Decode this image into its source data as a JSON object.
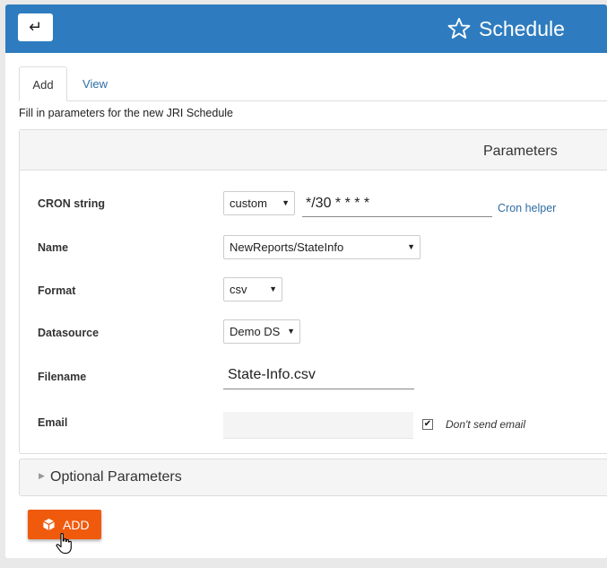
{
  "header": {
    "back_icon": "↵",
    "title": "Schedule",
    "title_icon": "star-icon"
  },
  "tabs": [
    {
      "label": "Add",
      "active": true
    },
    {
      "label": "View",
      "active": false
    }
  ],
  "intro": "Fill in parameters for the new JRI Schedule",
  "parameters": {
    "title": "Parameters",
    "cron": {
      "label": "CRON string",
      "mode": "custom",
      "value": "*/30 * * * *",
      "helper": "Cron helper"
    },
    "name": {
      "label": "Name",
      "value": "NewReports/StateInfo"
    },
    "format": {
      "label": "Format",
      "value": "csv"
    },
    "datasource": {
      "label": "Datasource",
      "value": "Demo DS"
    },
    "filename": {
      "label": "Filename",
      "value": "State-Info.csv"
    },
    "email": {
      "label": "Email",
      "value": "",
      "dont_send_label": "Don't send email",
      "dont_send_checked": true
    }
  },
  "optional": {
    "label": "Optional Parameters"
  },
  "actions": {
    "add_label": "ADD"
  },
  "colors": {
    "header": "#2e7cbf",
    "link": "#2e6da4",
    "add_button": "#f05a0d"
  }
}
